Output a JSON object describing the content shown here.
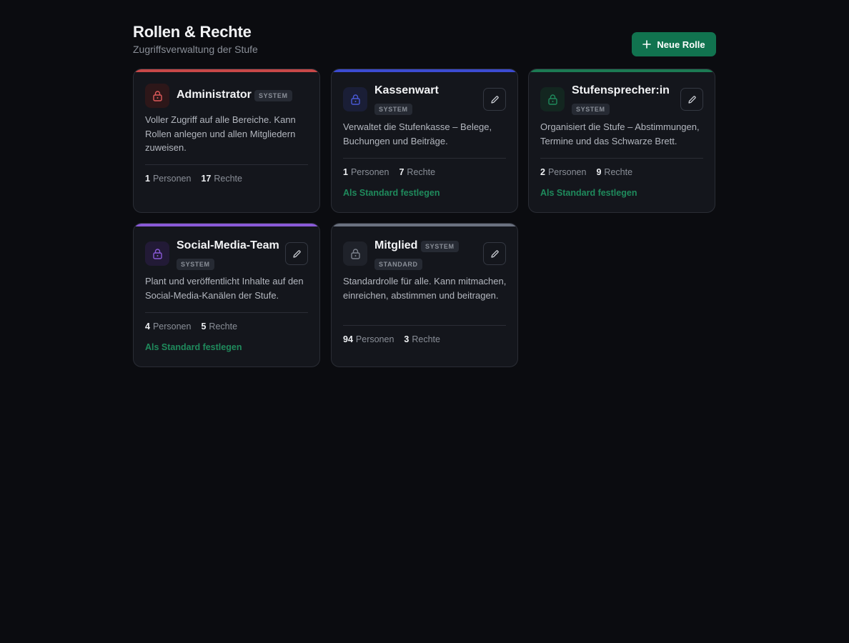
{
  "header": {
    "title": "Rollen & Rechte",
    "subtitle": "Zugriffsverwaltung der Stufe",
    "new_button_label": "Neue Rolle",
    "new_button_icon": "plus-icon"
  },
  "roles": [
    {
      "name": "Administrator",
      "badges": [
        "SYSTEM"
      ],
      "accent": "#c84848",
      "icon_color": "#e05a5a",
      "icon_bg": "#2d1719",
      "description": "Voller Zugriff auf alle Bereiche. Kann Rollen anlegen und allen Mitgliedern zuweisen.",
      "personen_count": "1",
      "personen_label": "Personen",
      "rechte_count": "17",
      "rechte_label": "Rechte",
      "editable": false
    },
    {
      "name": "Kassenwart",
      "badges": [
        "SYSTEM"
      ],
      "accent": "#3b4bd1",
      "icon_color": "#4a5ad8",
      "icon_bg": "#1a1e36",
      "description": "Verwaltet die Stufenkasse – Belege, Buchungen und Beiträge.",
      "personen_count": "1",
      "personen_label": "Personen",
      "rechte_count": "7",
      "rechte_label": "Rechte",
      "standard_link": "Als Standard festlegen",
      "editable": true
    },
    {
      "name": "Stufensprecher:in",
      "badges": [
        "SYSTEM"
      ],
      "accent": "#1c7a53",
      "icon_color": "#1f8a5c",
      "icon_bg": "#132620",
      "description": "Organisiert die Stufe – Abstimmungen, Termine und das Schwarze Brett.",
      "personen_count": "2",
      "personen_label": "Personen",
      "rechte_count": "9",
      "rechte_label": "Rechte",
      "standard_link": "Als Standard festlegen",
      "editable": true
    },
    {
      "name": "Social-Media-Team",
      "badges": [
        "SYSTEM"
      ],
      "accent": "#8a5ad8",
      "icon_color": "#8a5ad8",
      "icon_bg": "#221a36",
      "description": "Plant und veröffentlicht Inhalte auf den Social-Media-Kanälen der Stufe.",
      "personen_count": "4",
      "personen_label": "Personen",
      "rechte_count": "5",
      "rechte_label": "Rechte",
      "standard_link": "Als Standard festlegen",
      "editable": true
    },
    {
      "name": "Mitglied",
      "badges": [
        "SYSTEM",
        "STANDARD"
      ],
      "accent": "#6b7280",
      "icon_color": "#7b818c",
      "icon_bg": "#1f222a",
      "description": "Standardrolle für alle. Kann mitmachen, einreichen, abstimmen und beitragen.",
      "personen_count": "94",
      "personen_label": "Personen",
      "rechte_count": "3",
      "rechte_label": "Rechte",
      "editable": true
    }
  ]
}
